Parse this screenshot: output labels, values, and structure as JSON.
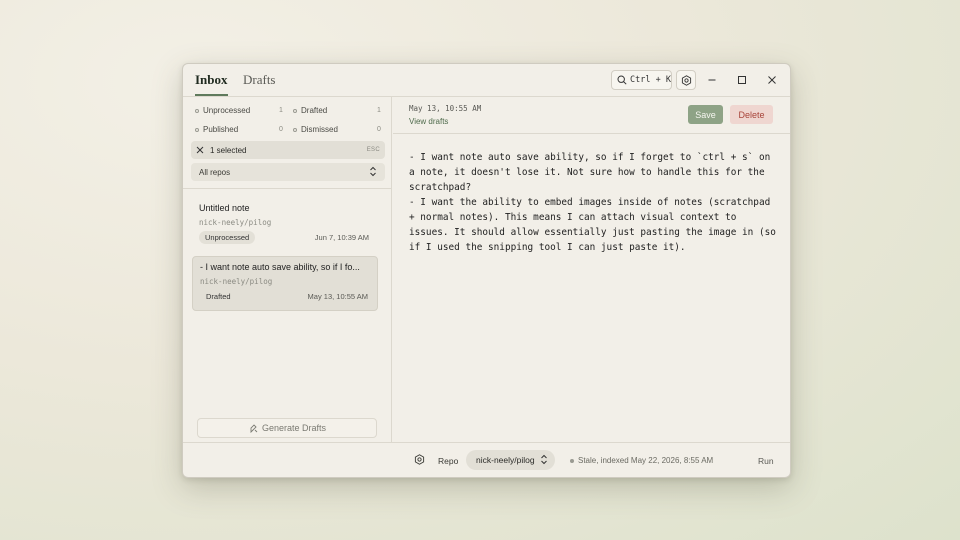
{
  "tabs": {
    "inbox": "Inbox",
    "drafts": "Drafts"
  },
  "toolbar": {
    "search_shortcut": "Ctrl + K"
  },
  "filters": [
    {
      "label": "Unprocessed",
      "count": "1"
    },
    {
      "label": "Drafted",
      "count": "1"
    },
    {
      "label": "Published",
      "count": "0"
    },
    {
      "label": "Dismissed",
      "count": "0"
    }
  ],
  "selection": {
    "label": "1 selected",
    "esc": "ESC"
  },
  "repo_filter": {
    "label": "All repos"
  },
  "notes": [
    {
      "title": "Untitled note",
      "repo": "nick-neely/pilog",
      "status": "Unprocessed",
      "date": "Jun 7, 10:39 AM"
    },
    {
      "title": "- I want note auto save ability, so if I fo...",
      "repo": "nick-neely/pilog",
      "status": "Drafted",
      "date": "May 13, 10:55 AM"
    }
  ],
  "generate_button": "Generate Drafts",
  "editor": {
    "date": "May 13, 10:55 AM",
    "view_drafts": "View drafts",
    "save": "Save",
    "delete": "Delete",
    "content": "- I want note auto save ability, so if I forget to `ctrl + s` on a note, it doesn't lose it. Not sure how to handle this for the scratchpad?\n- I want the ability to embed images inside of notes (scratchpad + normal notes). This means I can attach visual context to issues. It should allow essentially just pasting the image in (so if I used the snipping tool I can just paste it)."
  },
  "footer": {
    "repo_label": "Repo",
    "repo_value": "nick-neely/pilog",
    "status": "Stale, indexed May 22, 2026, 8:55 AM",
    "run": "Run"
  },
  "colors": {
    "accent": "#8ea386",
    "danger": "#a8443a",
    "danger_bg": "#efd6d0",
    "link": "#4f6b4c"
  }
}
